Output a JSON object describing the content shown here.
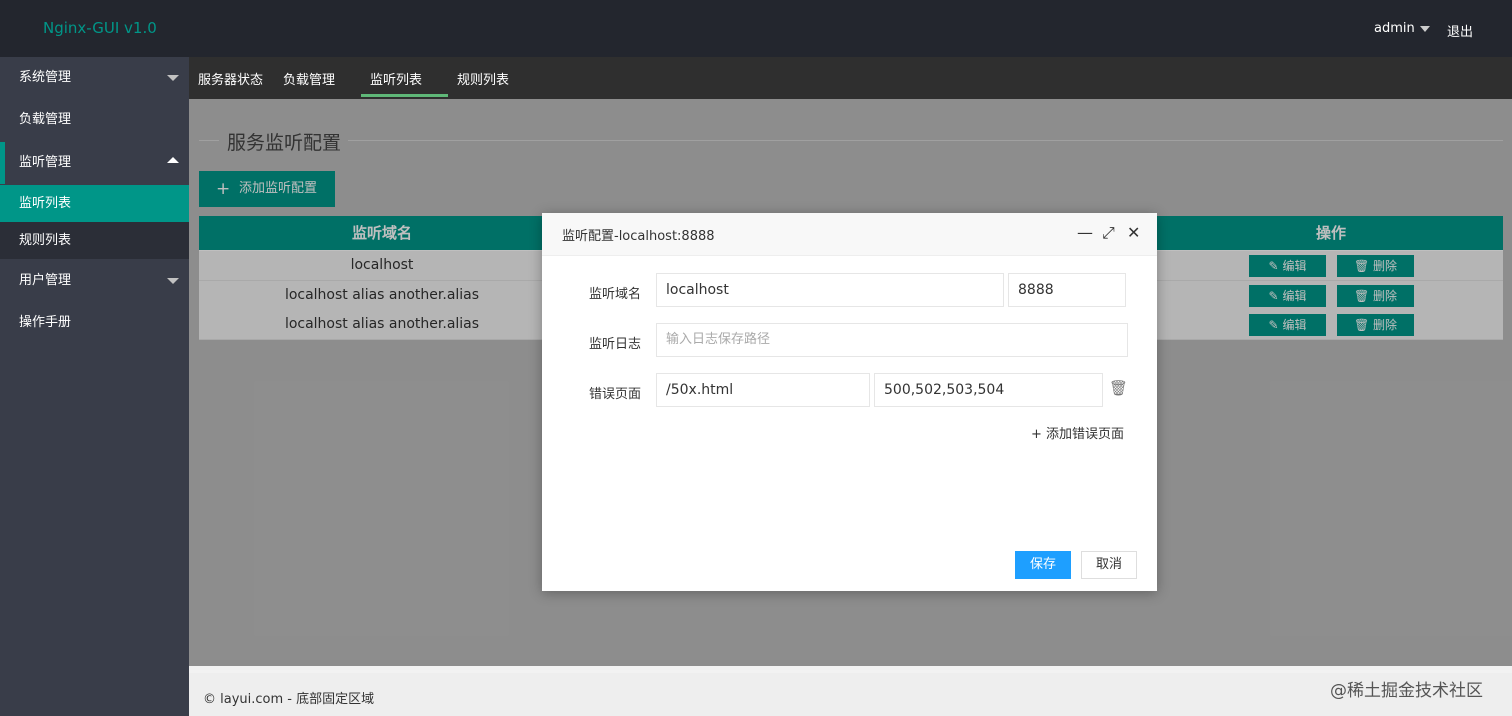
{
  "header": {
    "brand": "Nginx-GUI v1.0",
    "user": "admin",
    "logout": "退出"
  },
  "sidebar": {
    "items": [
      {
        "label": "系统管理"
      },
      {
        "label": "负载管理"
      },
      {
        "label": "监听管理"
      },
      {
        "label": "监听列表"
      },
      {
        "label": "规则列表"
      },
      {
        "label": "用户管理"
      },
      {
        "label": "操作手册"
      }
    ]
  },
  "tabs": [
    {
      "label": "服务器状态"
    },
    {
      "label": "负载管理"
    },
    {
      "label": "监听列表"
    },
    {
      "label": "规则列表"
    }
  ],
  "main": {
    "legend": "服务监听配置",
    "add_button": "添加监听配置"
  },
  "table": {
    "headers": {
      "domain": "监听域名",
      "ops": "操作"
    },
    "rows": [
      {
        "domain": "localhost"
      },
      {
        "domain": "localhost alias another.alias"
      },
      {
        "domain": "localhost alias another.alias"
      }
    ],
    "edit_label": "编辑",
    "delete_label": "删除"
  },
  "dialog": {
    "title": "监听配置-localhost:8888",
    "domain_label": "监听域名",
    "domain_value": "localhost",
    "port_value": "8888",
    "log_label": "监听日志",
    "log_placeholder": "输入日志保存路径",
    "error_label": "错误页面",
    "error_page_value": "/50x.html",
    "error_codes_value": "500,502,503,504",
    "add_error_page": "添加错误页面",
    "save": "保存",
    "cancel": "取消"
  },
  "footer": {
    "text": "© layui.com - 底部固定区域"
  },
  "watermark": {
    "text": "@稀土掘金技术社区"
  },
  "colors": {
    "accent": "#009688",
    "primary": "#1e9fff",
    "topbar": "#23262e",
    "sidebar": "#393d49"
  }
}
